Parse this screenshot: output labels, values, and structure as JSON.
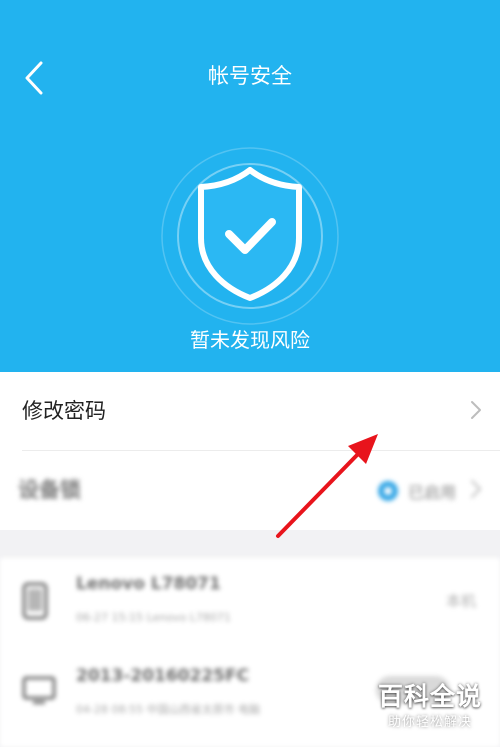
{
  "header": {
    "title": "帐号安全",
    "status": "暂未发现风险",
    "back_icon": "chevron-left-icon",
    "shield_icon": "shield-check-icon",
    "bg_color": "#22b3ef"
  },
  "security_items": [
    {
      "label": "修改密码",
      "icon": "chevron-right-icon"
    },
    {
      "label": "设备锁",
      "status": "已启用",
      "icon": "chevron-right-icon",
      "status_color": "#35a7e6"
    }
  ],
  "devices": [
    {
      "name": "Lenovo L78071",
      "meta": "06-27 15:15 Lenovo L78071",
      "tag": "本机",
      "icon": "phone-icon"
    },
    {
      "name": "2013-20160225FC",
      "meta": "04-28 08:55 中国山西省太原市 电脑",
      "icon": "monitor-icon"
    }
  ],
  "annotation": {
    "icon": "red-arrow-icon",
    "color": "#e8141c"
  },
  "watermark": {
    "main": "百科全说",
    "sub": "助你轻松解决"
  }
}
